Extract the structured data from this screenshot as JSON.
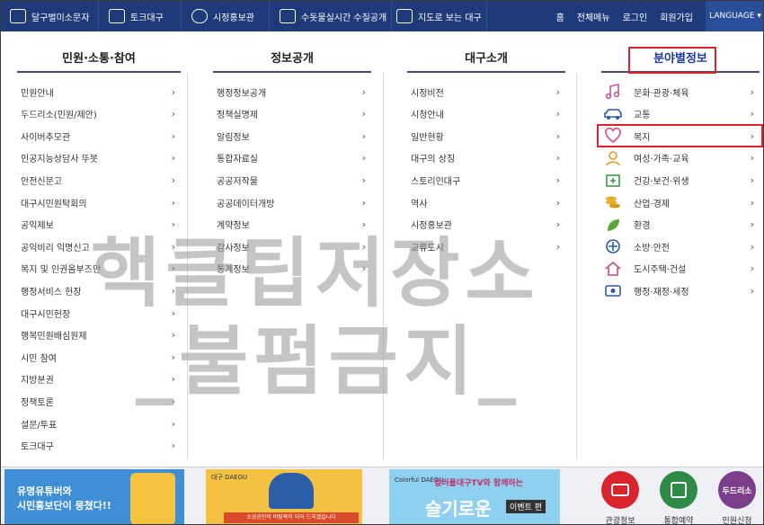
{
  "topbar": {
    "items": [
      "달구벌미소문자",
      "토크대구",
      "시정홍보관",
      "수돗물실시간 수질공개",
      "지도로 보는 대구"
    ],
    "right": [
      "홈",
      "전체메뉴",
      "로그인",
      "회원가입"
    ],
    "lang": "LANGUAGE ▾"
  },
  "columns": [
    {
      "title": "민원·소통·참여",
      "items": [
        "민원안내",
        "두드리소(민원/제안)",
        "사이버추모관",
        "인공지능상담사 뚜봇",
        "안전신문고",
        "대구시민원탁회의",
        "공익제보",
        "공익비리 익명신고",
        "복지 및 인권옴부즈만",
        "행정서비스 헌장",
        "대구시민헌장",
        "행복민원배심원제",
        "시민 참여",
        "지방분권",
        "정책토론",
        "설문/투표",
        "토크대구"
      ]
    },
    {
      "title": "정보공개",
      "items": [
        "행정정보공개",
        "정책실명제",
        "알림정보",
        "통합자료실",
        "공공저작물",
        "공공데이터개방",
        "계약정보",
        "감사정보",
        "통계정보"
      ]
    },
    {
      "title": "대구소개",
      "items": [
        "시정비전",
        "시청안내",
        "일반현황",
        "대구의 상징",
        "스토리인대구",
        "역사",
        "시정홍보관",
        "교류도시"
      ]
    },
    {
      "title": "분야별정보",
      "items": [
        "문화·관광·체육",
        "교통",
        "복지",
        "여성·가족·교육",
        "건강·보건·위생",
        "산업·경제",
        "환경",
        "소방·안전",
        "도시주택·건설",
        "행정·재정·세정"
      ],
      "icons": [
        "music-note-icon",
        "car-icon",
        "heart-icon",
        "person-icon",
        "medical-kit-icon",
        "coins-icon",
        "leaf-icon",
        "globe-icon",
        "house-icon",
        "money-icon"
      ]
    }
  ],
  "chevron": "›",
  "watermark": {
    "line1": "핵클팁저장소",
    "line2": "_불펌금지_"
  },
  "banners": {
    "b1": {
      "line1": "유명유튜버와",
      "line2": "시민홍보단이 뭉쳤다!!"
    },
    "b2": {
      "brand": "대구 DAEGU",
      "caption": "소상공인의 버팀목이 되어 드리겠습니다"
    },
    "b3": {
      "brand": "Colorful DAEGU",
      "title": "컬러풀대구TV와 함께하는",
      "big": "슬기로운",
      "tag": "이벤트 편"
    }
  },
  "quick": [
    "관광정보",
    "통합예약",
    "민원신청"
  ],
  "colors": {
    "navy": "#1e3a7a",
    "highlight": "#d9232d"
  }
}
